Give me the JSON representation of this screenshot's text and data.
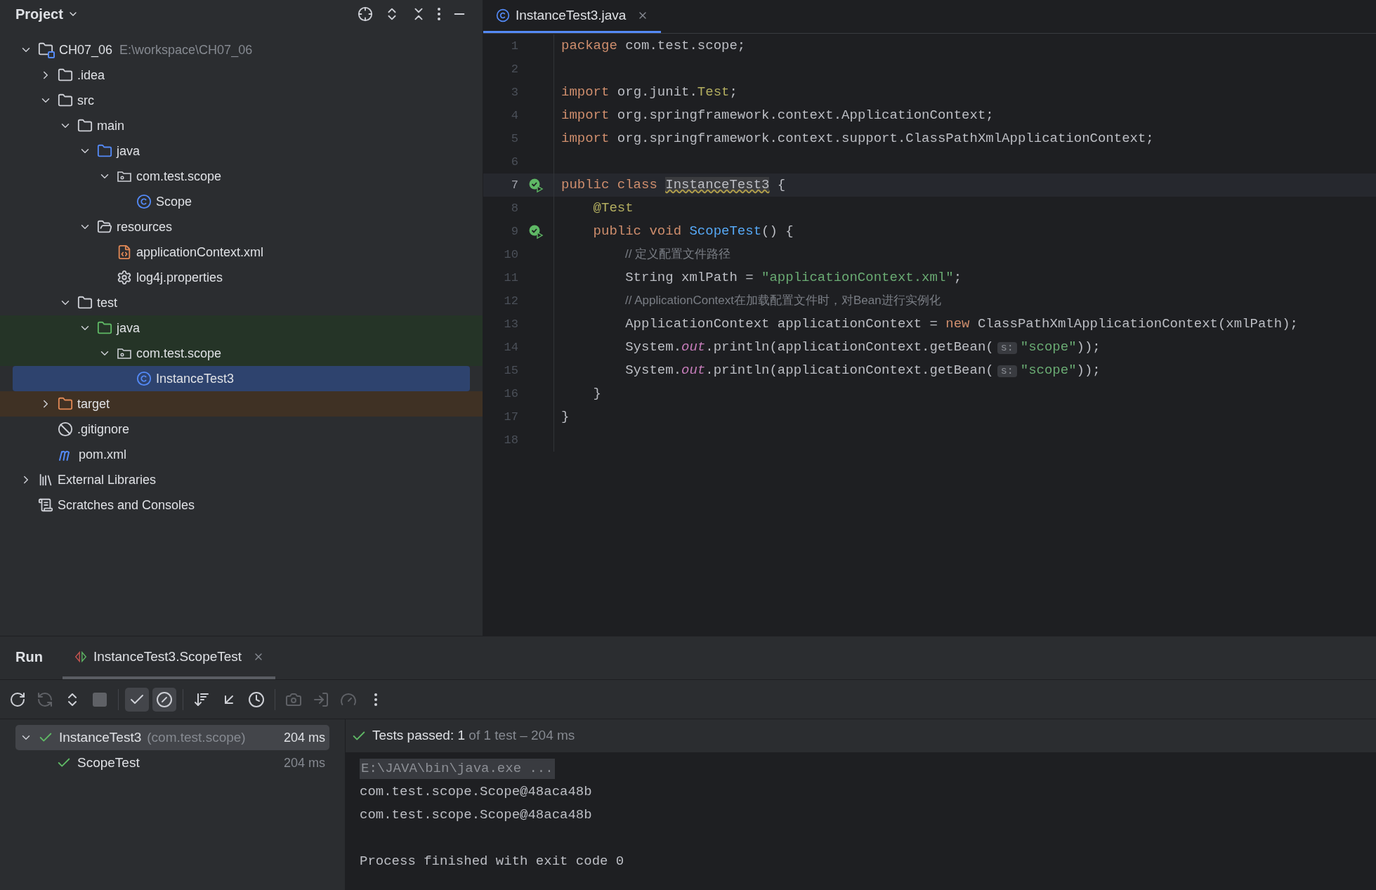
{
  "project_panel": {
    "title": "Project",
    "tree": [
      {
        "label": "CH07_06",
        "path": "E:\\workspace\\CH07_06",
        "kind": "module",
        "expanded": true,
        "selected": false,
        "children": [
          {
            "label": ".idea",
            "kind": "folder",
            "expanded": false,
            "selected": false
          },
          {
            "label": "src",
            "kind": "folder",
            "expanded": true,
            "selected": false,
            "children": [
              {
                "label": "main",
                "kind": "folder",
                "expanded": true,
                "selected": false,
                "children": [
                  {
                    "label": "java",
                    "kind": "sources",
                    "expanded": true,
                    "selected": false,
                    "children": [
                      {
                        "label": "com.test.scope",
                        "kind": "package",
                        "expanded": true,
                        "selected": false,
                        "children": [
                          {
                            "label": "Scope",
                            "kind": "class",
                            "selected": false
                          }
                        ]
                      }
                    ]
                  },
                  {
                    "label": "resources",
                    "kind": "resources",
                    "expanded": true,
                    "selected": false,
                    "children": [
                      {
                        "label": "applicationContext.xml",
                        "kind": "xml",
                        "selected": false
                      },
                      {
                        "label": "log4j.properties",
                        "kind": "properties",
                        "selected": false
                      }
                    ]
                  }
                ]
              },
              {
                "label": "test",
                "kind": "folder",
                "expanded": true,
                "selected": false,
                "children": [
                  {
                    "label": "java",
                    "kind": "tests",
                    "color": "#253427",
                    "expanded": true,
                    "selected": false,
                    "children": [
                      {
                        "label": "com.test.scope",
                        "kind": "package",
                        "color": "#253427",
                        "expanded": true,
                        "selected": false,
                        "children": [
                          {
                            "label": "InstanceTest3",
                            "kind": "class",
                            "selected": true
                          }
                        ]
                      }
                    ]
                  }
                ]
              }
            ]
          },
          {
            "label": "target",
            "kind": "excluded",
            "color": "#3f3124",
            "expanded": false,
            "selected": false
          },
          {
            "label": ".gitignore",
            "kind": "ignore",
            "selected": false
          },
          {
            "label": "pom.xml",
            "kind": "maven",
            "selected": false
          }
        ]
      },
      {
        "label": "External Libraries",
        "kind": "libraries",
        "expanded": false,
        "selected": false
      },
      {
        "label": "Scratches and Consoles",
        "kind": "scratches",
        "selected": false
      }
    ]
  },
  "editor": {
    "tabs": [
      {
        "label": "InstanceTest3.java",
        "selected": true
      }
    ],
    "lines": [
      {
        "number": "1",
        "current": false,
        "run": false,
        "tokens": [
          {
            "kind": "keyword",
            "text": "package "
          },
          {
            "kind": "plain",
            "text": "com.test.scope;"
          }
        ]
      },
      {
        "number": "2",
        "current": false,
        "run": false
      },
      {
        "number": "3",
        "current": false,
        "run": false,
        "tokens": [
          {
            "kind": "keyword",
            "text": "import "
          },
          {
            "kind": "plain",
            "text": "org.junit."
          },
          {
            "kind": "annotation",
            "text": "Test"
          },
          {
            "kind": "plain",
            "text": ";"
          }
        ]
      },
      {
        "number": "4",
        "current": false,
        "run": false,
        "tokens": [
          {
            "kind": "keyword",
            "text": "import "
          },
          {
            "kind": "plain",
            "text": "org.springframework.context.ApplicationContext;"
          }
        ]
      },
      {
        "number": "5",
        "current": false,
        "run": false,
        "tokens": [
          {
            "kind": "keyword",
            "text": "import "
          },
          {
            "kind": "plain",
            "text": "org.springframework.context.support.ClassPathXmlApplicationContext;"
          }
        ]
      },
      {
        "number": "6",
        "current": false,
        "run": false
      },
      {
        "number": "7",
        "current": true,
        "run": true,
        "tokens": [
          {
            "kind": "keyword",
            "text": "public class "
          },
          {
            "kind": "warning",
            "text": "InstanceTest3"
          },
          {
            "kind": "plain",
            "text": " {"
          }
        ]
      },
      {
        "number": "8",
        "current": false,
        "run": false,
        "tokens": [
          {
            "kind": "annotation",
            "text": "    @Test"
          }
        ]
      },
      {
        "number": "9",
        "current": false,
        "run": true,
        "tokens": [
          {
            "kind": "keyword",
            "text": "    public void "
          },
          {
            "kind": "method",
            "text": "ScopeTest"
          },
          {
            "kind": "plain",
            "text": "() {"
          }
        ]
      },
      {
        "number": "10",
        "current": false,
        "run": false,
        "tokens": [
          {
            "kind": "comment",
            "text": "// 定义配置文件路径"
          }
        ]
      },
      {
        "number": "11",
        "current": false,
        "run": false,
        "tokens": [
          {
            "kind": "plain",
            "text": "        String xmlPath = "
          },
          {
            "kind": "string",
            "text": "\"applicationContext.xml\""
          },
          {
            "kind": "plain",
            "text": ";"
          }
        ]
      },
      {
        "number": "12",
        "current": false,
        "run": false,
        "tokens": [
          {
            "kind": "comment",
            "text": "// ApplicationContext在加载配置文件时，对Bean进行实例化"
          }
        ]
      },
      {
        "number": "13",
        "current": false,
        "run": false,
        "tokens": [
          {
            "kind": "plain",
            "text": "        ApplicationContext applicationContext = "
          },
          {
            "kind": "keyword",
            "text": "new "
          },
          {
            "kind": "plain",
            "text": "ClassPathXmlApplicationContext(xmlPath);"
          }
        ]
      },
      {
        "number": "14",
        "current": false,
        "run": false,
        "tokens": [
          {
            "kind": "plain",
            "text": "        System."
          },
          {
            "kind": "field",
            "text": "out"
          },
          {
            "kind": "plain",
            "text": ".println(applicationContext.getBean("
          },
          {
            "kind": "hint",
            "text": "s:"
          },
          {
            "kind": "string",
            "text": "\"scope\""
          },
          {
            "kind": "plain",
            "text": "));"
          }
        ]
      },
      {
        "number": "15",
        "current": false,
        "run": false,
        "tokens": [
          {
            "kind": "plain",
            "text": "        System."
          },
          {
            "kind": "field",
            "text": "out"
          },
          {
            "kind": "plain",
            "text": ".println(applicationContext.getBean("
          },
          {
            "kind": "hint",
            "text": "s:"
          },
          {
            "kind": "string",
            "text": "\"scope\""
          },
          {
            "kind": "plain",
            "text": "));"
          }
        ]
      },
      {
        "number": "16",
        "current": false,
        "run": false,
        "tokens": [
          {
            "kind": "plain",
            "text": "    }"
          }
        ]
      },
      {
        "number": "17",
        "current": false,
        "run": false,
        "tokens": [
          {
            "kind": "plain",
            "text": "}"
          }
        ]
      },
      {
        "number": "18",
        "current": false,
        "run": false
      }
    ]
  },
  "run_panel": {
    "title": "Run",
    "tabs": [
      {
        "label": "InstanceTest3.ScopeTest",
        "selected": true
      }
    ],
    "toolbar": [
      {
        "kind": "rerun",
        "disabled": false,
        "selected": false
      },
      {
        "kind": "rerun-failed",
        "disabled": true,
        "selected": false
      },
      {
        "kind": "toggle-auto",
        "disabled": false,
        "selected": false
      },
      {
        "kind": "stop",
        "disabled": true,
        "selected": false
      },
      {
        "kind": "separator"
      },
      {
        "kind": "show-passed",
        "disabled": false,
        "selected": true
      },
      {
        "kind": "show-ignored",
        "disabled": false,
        "selected": true
      },
      {
        "kind": "separator"
      },
      {
        "kind": "sort",
        "disabled": false,
        "selected": false
      },
      {
        "kind": "collapse",
        "disabled": false,
        "selected": false
      },
      {
        "kind": "history",
        "disabled": false,
        "selected": false
      },
      {
        "kind": "separator"
      },
      {
        "kind": "camera",
        "disabled": true,
        "selected": false
      },
      {
        "kind": "import",
        "disabled": true,
        "selected": false
      },
      {
        "kind": "gauge",
        "disabled": true,
        "selected": false
      },
      {
        "kind": "more",
        "disabled": false,
        "selected": false
      }
    ],
    "tests": [
      {
        "name": "InstanceTest3",
        "package": "(com.test.scope)",
        "time": "204 ms",
        "expanded": true,
        "selected": true,
        "children": [
          {
            "name": "ScopeTest",
            "time": "204 ms",
            "selected": false
          }
        ]
      }
    ],
    "summary": {
      "passed": "Tests passed: 1",
      "rest": "of 1 test – 204 ms"
    },
    "console": [
      {
        "kind": "command",
        "text": "E:\\JAVA\\bin\\java.exe ..."
      },
      {
        "kind": "output",
        "text": "com.test.scope.Scope@48aca48b"
      },
      {
        "kind": "output",
        "text": "com.test.scope.Scope@48aca48b"
      },
      {
        "kind": "blank"
      },
      {
        "kind": "output",
        "text": "Process finished with exit code 0"
      }
    ]
  }
}
